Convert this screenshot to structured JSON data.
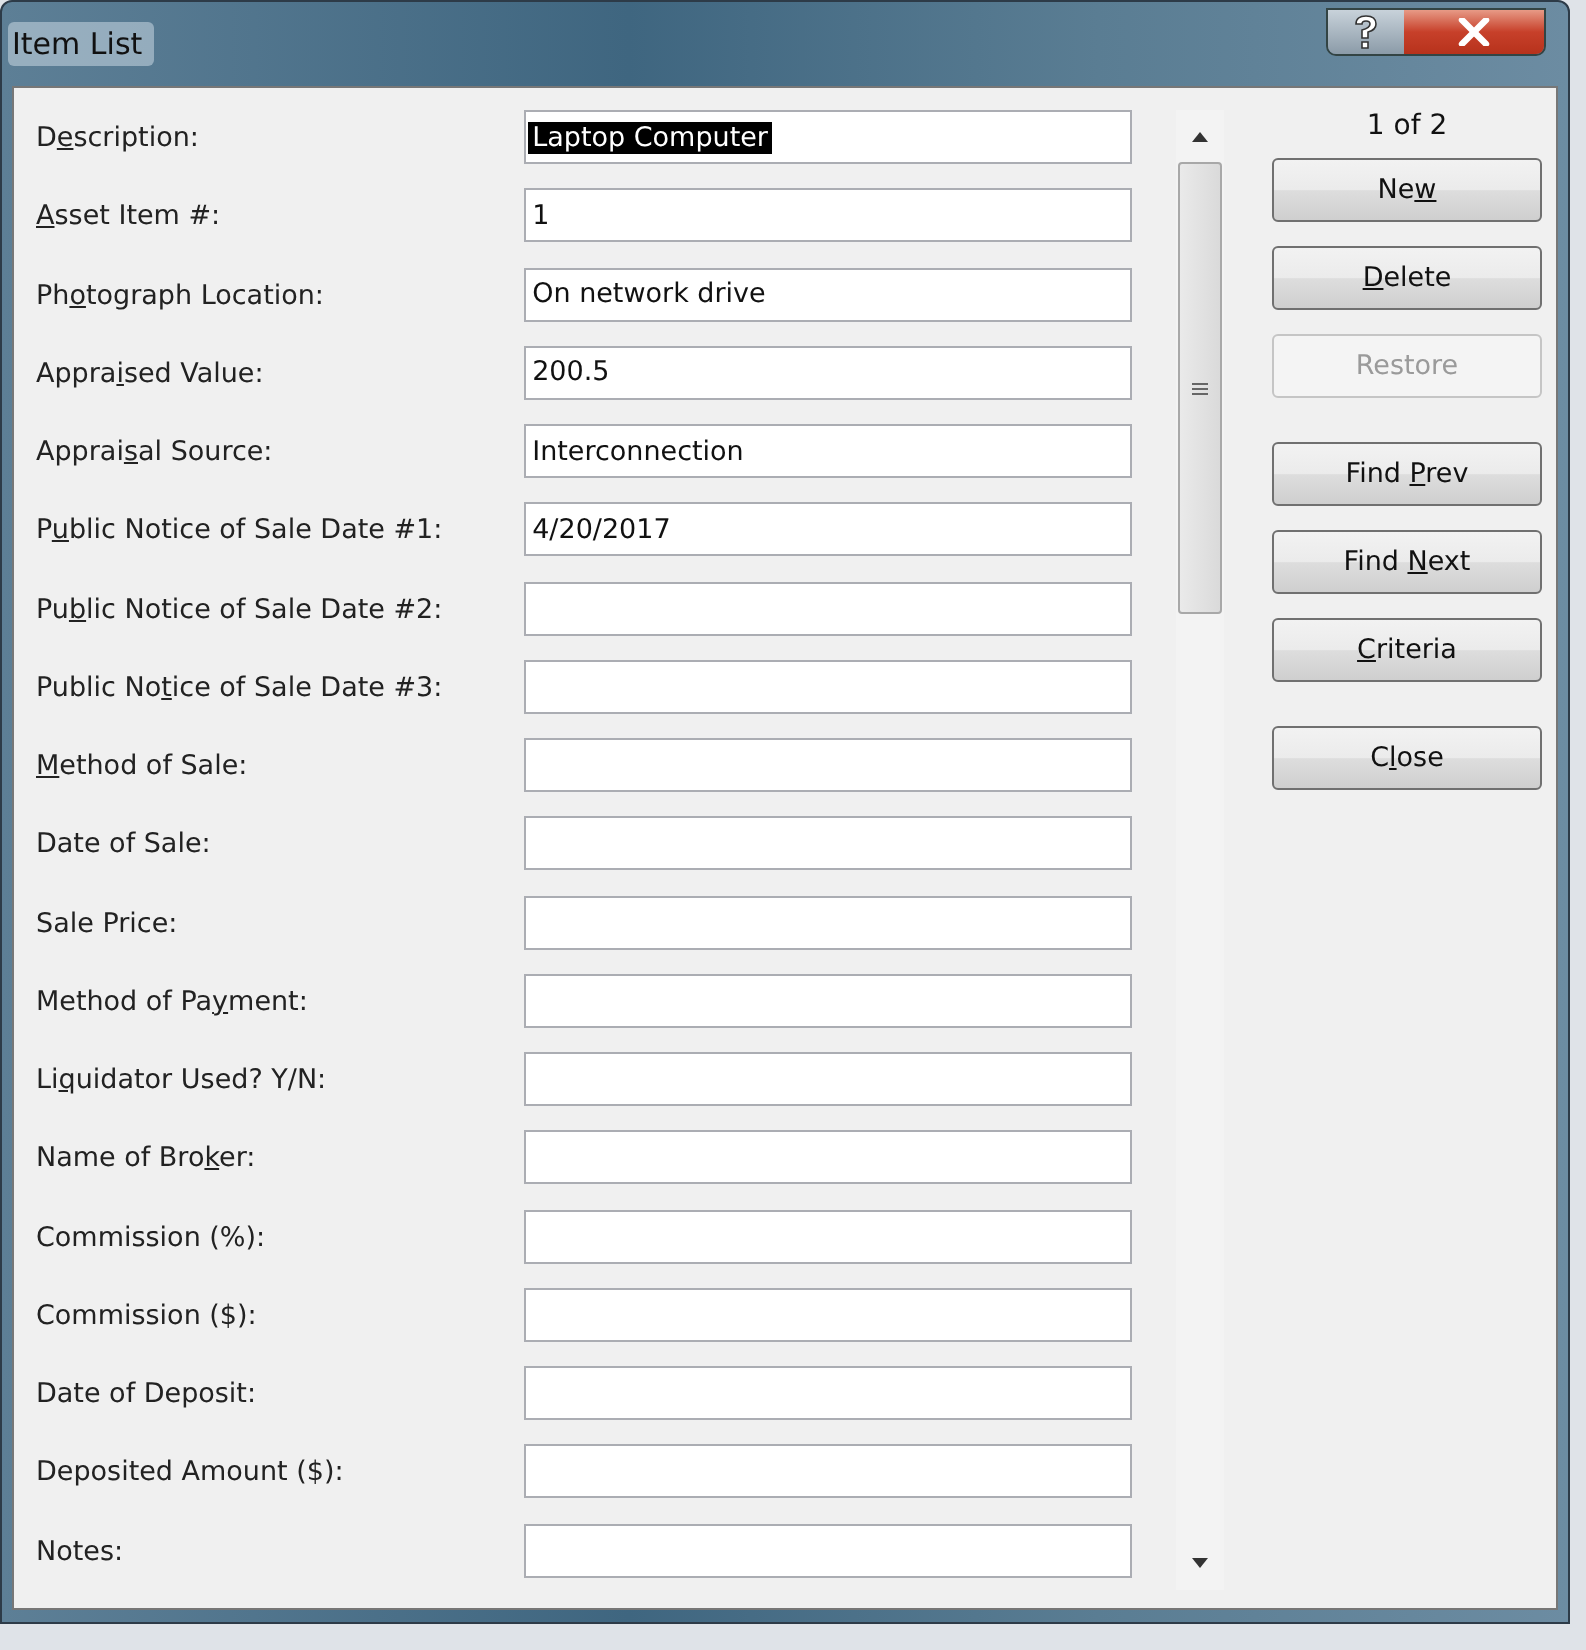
{
  "window": {
    "title": "Item List"
  },
  "fields": [
    {
      "label": {
        "before": "D",
        "key": "e",
        "after": "scription:"
      },
      "value": "Laptop Computer",
      "text_selected": true
    },
    {
      "label": {
        "key": "A",
        "after": "sset Item #:"
      },
      "value": "1",
      "text_selected": false
    },
    {
      "label": {
        "before": "Ph",
        "key": "o",
        "after": "tograph Location:"
      },
      "value": "On network drive",
      "text_selected": false
    },
    {
      "label": {
        "before": "Appra",
        "key": "i",
        "after": "sed Value:"
      },
      "value": "200.5",
      "text_selected": false
    },
    {
      "label": {
        "before": "Apprai",
        "key": "s",
        "after": "al Source:"
      },
      "value": "Interconnection",
      "text_selected": false
    },
    {
      "label": {
        "before": "P",
        "key": "u",
        "after": "blic Notice of Sale Date #1:"
      },
      "value": "4/20/2017",
      "text_selected": false
    },
    {
      "label": {
        "before": "Pu",
        "key": "b",
        "after": "lic Notice of Sale Date #2:"
      }
    },
    {
      "label": {
        "before": "Public No",
        "key": "t",
        "after": "ice of Sale Date #3:"
      }
    },
    {
      "label": {
        "key": "M",
        "after": "ethod of Sale:"
      }
    },
    {
      "label": {
        "before": "Date of Sale:"
      }
    },
    {
      "label": {
        "before": "Sale Price:"
      }
    },
    {
      "label": {
        "before": "Method of Pa",
        "key": "y",
        "after": "ment:"
      }
    },
    {
      "label": {
        "before": "Li",
        "key": "q",
        "after": "uidator Used? Y/N:"
      }
    },
    {
      "label": {
        "before": "Name of Bro",
        "key": "k",
        "after": "er:"
      }
    },
    {
      "label": {
        "before": "Commission (%):"
      }
    },
    {
      "label": {
        "before": "Commission ($):"
      }
    },
    {
      "label": {
        "before": "Date of Deposit:"
      }
    },
    {
      "label": {
        "before": "Deposited Amount ($):"
      }
    },
    {
      "label": {
        "before": "Notes:"
      }
    }
  ],
  "record_counter": "1 of 2",
  "button_groups": [
    [
      {
        "label": {
          "before": "Ne",
          "key": "w"
        },
        "disabled": false
      },
      {
        "label": {
          "key": "D",
          "after": "elete"
        },
        "disabled": false
      },
      {
        "label": {
          "before": "Restore"
        },
        "disabled": true
      }
    ],
    [
      {
        "label": {
          "before": "Find ",
          "key": "P",
          "after": "rev"
        },
        "disabled": false
      },
      {
        "label": {
          "before": "Find ",
          "key": "N",
          "after": "ext"
        },
        "disabled": false
      },
      {
        "label": {
          "key": "C",
          "after": "riteria"
        },
        "disabled": false
      }
    ],
    [
      {
        "label": {
          "before": "C",
          "key": "l",
          "after": "ose"
        },
        "disabled": false
      }
    ]
  ]
}
